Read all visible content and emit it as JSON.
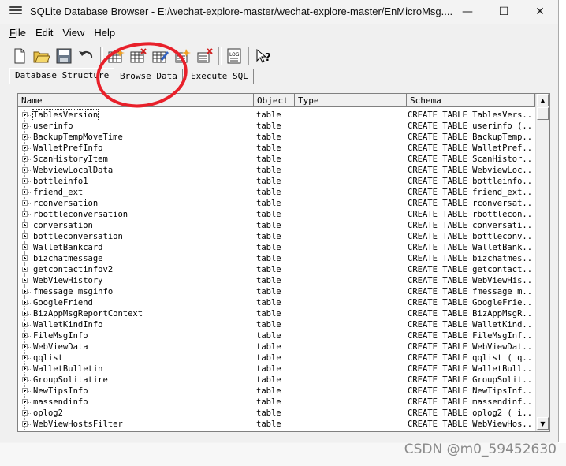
{
  "window": {
    "title": "SQLite Database Browser - E:/wechat-explore-master/wechat-explore-master/EnMicroMsg...."
  },
  "window_controls": [
    "—",
    "☐",
    "✕"
  ],
  "menu": [
    {
      "first": "F",
      "rest": "ile"
    },
    {
      "first": "",
      "rest": "Edit"
    },
    {
      "first": "",
      "rest": "View"
    },
    {
      "first": "",
      "rest": "Help"
    }
  ],
  "toolbar_icons": [
    "new-file-icon",
    "open-folder-icon",
    "save-icon",
    "undo-icon",
    "create-table-icon",
    "delete-table-icon",
    "modify-table-icon",
    "create-index-icon",
    "delete-index-icon",
    "log-icon",
    "whats-this-icon"
  ],
  "tabs": [
    "Database Structure",
    "Browse Data",
    "Execute SQL"
  ],
  "columns": [
    "Name",
    "Object",
    "Type",
    "Schema"
  ],
  "rows": [
    [
      "TablesVersion",
      "table",
      "",
      "CREATE TABLE TablesVers..."
    ],
    [
      "userinfo",
      "table",
      "",
      "CREATE TABLE userinfo (..."
    ],
    [
      "BackupTempMoveTime",
      "table",
      "",
      "CREATE TABLE BackupTemp..."
    ],
    [
      "WalletPrefInfo",
      "table",
      "",
      "CREATE TABLE WalletPref..."
    ],
    [
      "ScanHistoryItem",
      "table",
      "",
      "CREATE TABLE ScanHistor..."
    ],
    [
      "WebviewLocalData",
      "table",
      "",
      "CREATE TABLE WebviewLoc..."
    ],
    [
      "bottleinfo1",
      "table",
      "",
      "CREATE TABLE bottleinfo..."
    ],
    [
      "friend_ext",
      "table",
      "",
      "CREATE TABLE friend_ext..."
    ],
    [
      "rconversation",
      "table",
      "",
      "CREATE TABLE rconversat..."
    ],
    [
      "rbottleconversation",
      "table",
      "",
      "CREATE TABLE rbottlecon..."
    ],
    [
      "conversation",
      "table",
      "",
      "CREATE TABLE conversati..."
    ],
    [
      "bottleconversation",
      "table",
      "",
      "CREATE TABLE bottleconv..."
    ],
    [
      "WalletBankcard",
      "table",
      "",
      "CREATE TABLE WalletBank..."
    ],
    [
      "bizchatmessage",
      "table",
      "",
      "CREATE TABLE bizchatmes..."
    ],
    [
      "getcontactinfov2",
      "table",
      "",
      "CREATE TABLE getcontact..."
    ],
    [
      "WebViewHistory",
      "table",
      "",
      "CREATE TABLE WebViewHis..."
    ],
    [
      "fmessage_msginfo",
      "table",
      "",
      "CREATE TABLE fmessage_m..."
    ],
    [
      "GoogleFriend",
      "table",
      "",
      "CREATE TABLE GoogleFrie..."
    ],
    [
      "BizAppMsgReportContext",
      "table",
      "",
      "CREATE TABLE BizAppMsgR..."
    ],
    [
      "WalletKindInfo",
      "table",
      "",
      "CREATE TABLE WalletKind..."
    ],
    [
      "FileMsgInfo",
      "table",
      "",
      "CREATE TABLE FileMsgInf..."
    ],
    [
      "WebViewData",
      "table",
      "",
      "CREATE TABLE WebViewDat..."
    ],
    [
      "qqlist",
      "table",
      "",
      "CREATE TABLE qqlist ( q..."
    ],
    [
      "WalletBulletin",
      "table",
      "",
      "CREATE TABLE WalletBull..."
    ],
    [
      "GroupSolitatire",
      "table",
      "",
      "CREATE TABLE GroupSolit..."
    ],
    [
      "NewTipsInfo",
      "table",
      "",
      "CREATE TABLE NewTipsInf..."
    ],
    [
      "massendinfo",
      "table",
      "",
      "CREATE TABLE massendinf..."
    ],
    [
      "oplog2",
      "table",
      "",
      "CREATE TABLE oplog2 ( i..."
    ],
    [
      "WebViewHostsFilter",
      "table",
      "",
      "CREATE TABLE WebViewHos..."
    ]
  ],
  "watermark": "CSDN @m0_59452630",
  "annotation_color": "#e8202a"
}
